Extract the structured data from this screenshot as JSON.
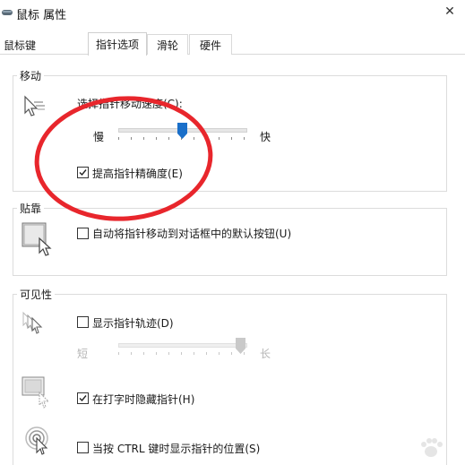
{
  "window": {
    "title": "鼠标 属性",
    "close_glyph": "✕"
  },
  "tabs": [
    {
      "label": "鼠标键",
      "selected": false
    },
    {
      "label": "指针选项",
      "selected": true
    },
    {
      "label": "滑轮",
      "selected": false
    },
    {
      "label": "硬件",
      "selected": false
    }
  ],
  "motion": {
    "label": "移动",
    "speed_label": "选择指针移动速度(C):",
    "slow_label": "慢",
    "fast_label": "快",
    "speed_value": 0.5,
    "precision_label": "提高指针精确度(E)",
    "precision_checked": true
  },
  "snap_to": {
    "label": "贴靠",
    "default_button_label": "自动将指针移动到对话框中的默认按钮(U)",
    "default_button_checked": false
  },
  "visibility": {
    "label": "可见性",
    "trails_label": "显示指针轨迹(D)",
    "trails_checked": false,
    "short_label": "短",
    "long_label": "长",
    "trail_length_value": 1.0,
    "hide_typing_label": "在打字时隐藏指针(H)",
    "hide_typing_checked": true,
    "ctrl_label": "当按 CTRL 键时显示指针的位置(S)",
    "ctrl_checked": false
  },
  "colors": {
    "slider_thumb": "#1a6fc9",
    "slider_thumb_disabled": "#c9c9c9",
    "annotation_circle": "#e8262c"
  }
}
